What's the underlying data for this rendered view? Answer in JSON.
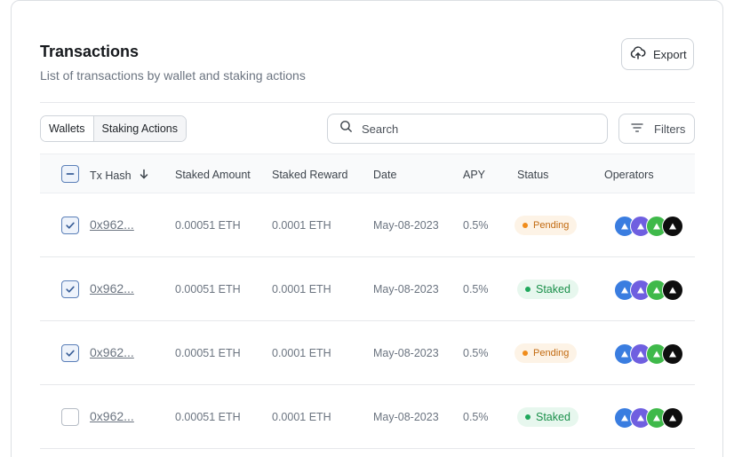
{
  "header": {
    "title": "Transactions",
    "subtitle": "List of transactions by wallet and staking actions",
    "export_label": "Export",
    "export_icon": "cloud-upload-icon"
  },
  "toolbar": {
    "segments": [
      "Wallets",
      "Staking Actions"
    ],
    "active_segment": "Wallets",
    "search_placeholder": "Search",
    "search_value": "",
    "filters_label": "Filters"
  },
  "table": {
    "columns": [
      "Tx Hash",
      "Staked Amount",
      "Staked Reward",
      "Date",
      "APY",
      "Status",
      "Operators"
    ],
    "sorted_column": "Tx Hash",
    "sort_direction": "descending",
    "select_all_state": "indeterminate",
    "rows": [
      {
        "checked": true,
        "hash": "0x962...",
        "amount": "0.00051 ETH",
        "reward": "0.0001 ETH",
        "date": "May-08-2023",
        "apy": "0.5%",
        "status": "Pending"
      },
      {
        "checked": true,
        "hash": "0x962...",
        "amount": "0.00051 ETH",
        "reward": "0.0001 ETH",
        "date": "May-08-2023",
        "apy": "0.5%",
        "status": "Staked"
      },
      {
        "checked": true,
        "hash": "0x962...",
        "amount": "0.00051 ETH",
        "reward": "0.0001 ETH",
        "date": "May-08-2023",
        "apy": "0.5%",
        "status": "Pending"
      },
      {
        "checked": false,
        "hash": "0x962...",
        "amount": "0.00051 ETH",
        "reward": "0.0001 ETH",
        "date": "May-08-2023",
        "apy": "0.5%",
        "status": "Staked"
      }
    ],
    "operator_colors": [
      "#3a7de0",
      "#6f5fe0",
      "#3fb94a",
      "#0e0e0e"
    ]
  },
  "colors": {
    "pending": "#f08c1b",
    "staked": "#1fa85c",
    "checkbox_accent": "#5a7fb8"
  }
}
